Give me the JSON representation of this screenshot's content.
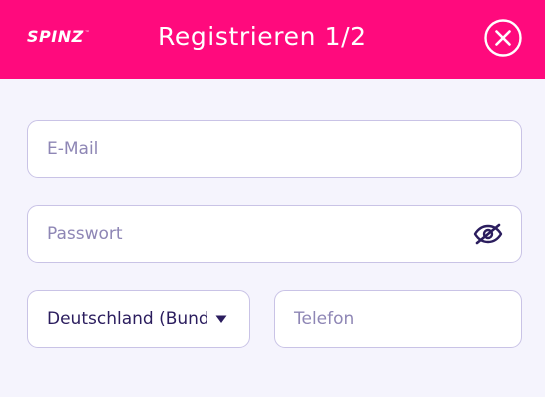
{
  "header": {
    "logo_text": "SPINZ",
    "logo_tm": "™",
    "title": "Registrieren 1/2",
    "close_icon": "close-circle-icon"
  },
  "form": {
    "email": {
      "placeholder": "E-Mail",
      "value": ""
    },
    "password": {
      "placeholder": "Passwort",
      "value": "",
      "toggle_icon": "eye-slash-icon"
    },
    "country": {
      "selected": "Deutschland (Bundesrepublik)",
      "icon": "caret-down-icon"
    },
    "phone": {
      "placeholder": "Telefon",
      "value": ""
    }
  },
  "colors": {
    "brand": "#ff0a7d",
    "background": "#f5f4fd",
    "field_border": "#c9c3e6",
    "placeholder": "#8e86b5",
    "text": "#2b1d5e"
  }
}
